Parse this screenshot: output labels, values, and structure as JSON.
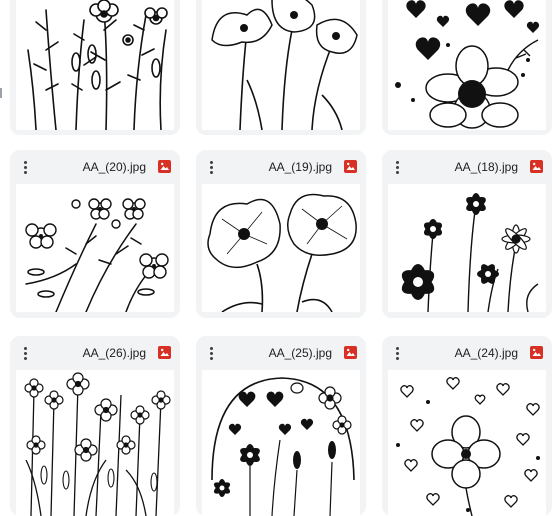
{
  "grid": {
    "files": [
      {
        "name": "",
        "art": "wildflowers-sketch"
      },
      {
        "name": "",
        "art": "poppies-sketch"
      },
      {
        "name": "",
        "art": "hearts-daisy"
      },
      {
        "name": "AA_(20).jpg",
        "art": "branching-blossoms"
      },
      {
        "name": "AA_(19).jpg",
        "art": "two-poppies"
      },
      {
        "name": "AA_(18).jpg",
        "art": "black-daisies"
      },
      {
        "name": "AA_(26).jpg",
        "art": "flower-meadow"
      },
      {
        "name": "AA_(25).jpg",
        "art": "hearts-and-flowers-circle"
      },
      {
        "name": "AA_(24).jpg",
        "art": "scattered-hearts-flower"
      }
    ],
    "menu_icon": "more-vert-icon",
    "file_type_icon": "image-file-icon",
    "accent_color": "#d93025"
  }
}
